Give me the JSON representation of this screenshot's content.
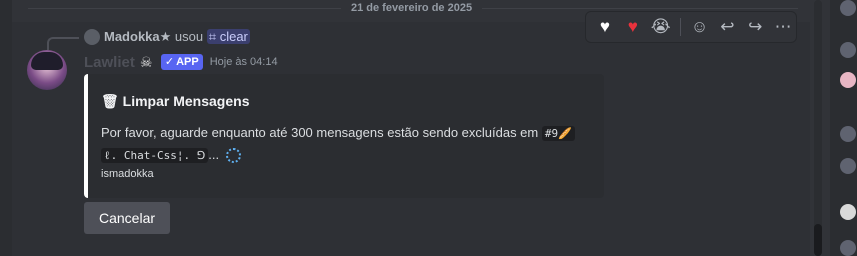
{
  "date_divider": "21 de fevereiro de 2025",
  "reply": {
    "username": "Madokka",
    "username_suffix": "★",
    "used_text": "usou",
    "command_icon": "⌗",
    "command": "clear"
  },
  "message": {
    "author": "Lawliet",
    "author_decoration": "skull-rose-icon",
    "badge": {
      "check": "✓",
      "label": "APP"
    },
    "timestamp": "Hoje às 04:14"
  },
  "embed": {
    "accent_color": "#ffffff",
    "title_icon": "🗑",
    "title": "Limpar Mensagens",
    "description_prefix": "Por favor, aguarde enquanto até 300 mensagens estão sendo excluídas em",
    "channel_code_1": "#9🥖",
    "channel_code_2": "ℓ. Chat-Css¦. ⅁",
    "ellipsis": "...",
    "footer": "ismadokka"
  },
  "buttons": {
    "cancel": "Cancelar"
  },
  "toolbar": {
    "reactions": [
      {
        "name": "white-heart-reaction",
        "glyph": "♥"
      },
      {
        "name": "red-heart-reaction",
        "glyph": "♥"
      },
      {
        "name": "crying-face-reaction",
        "glyph": "😭"
      }
    ],
    "add_reaction": "☺",
    "reply": "↩",
    "forward": "↪",
    "more": "⋯"
  },
  "colors": {
    "background": "#313338",
    "embed_bg": "#2b2d31",
    "app_badge": "#5865f2",
    "button_secondary": "#4e5058"
  }
}
